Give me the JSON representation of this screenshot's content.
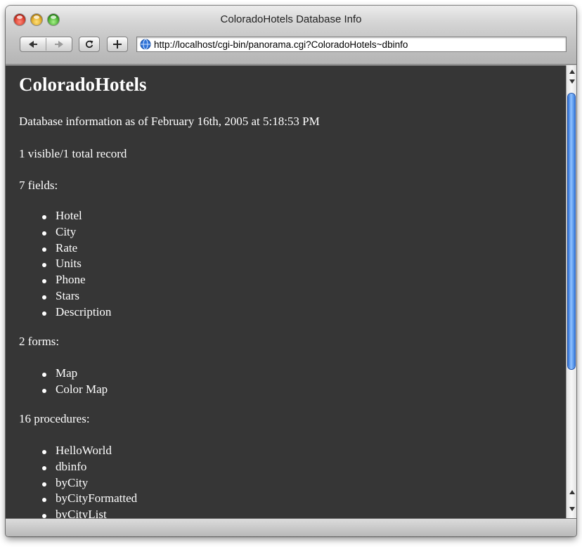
{
  "window": {
    "title": "ColoradoHotels Database Info"
  },
  "toolbar": {
    "back_icon": "back-arrow-icon",
    "forward_icon": "forward-arrow-icon",
    "reload_icon": "reload-icon",
    "add_icon": "plus-icon",
    "url": "http://localhost/cgi-bin/panorama.cgi?ColoradoHotels~dbinfo"
  },
  "page": {
    "heading": "ColoradoHotels",
    "info_line": "Database information as of February 16th, 2005 at 5:18:53 PM",
    "records_line": "1 visible/1 total record",
    "fields_heading": "7 fields:",
    "fields": [
      "Hotel",
      "City",
      "Rate",
      "Units",
      "Phone",
      "Stars",
      "Description"
    ],
    "forms_heading": "2 forms:",
    "forms": [
      "Map",
      "Color Map"
    ],
    "procedures_heading": "16 procedures:",
    "procedures": [
      "HelloWorld",
      "dbinfo",
      "byCity",
      "byCityFormatted",
      "byCityList"
    ]
  },
  "colors": {
    "content_background": "#363636",
    "content_text": "#ffffff",
    "scroll_thumb": "#3b7fe0"
  }
}
